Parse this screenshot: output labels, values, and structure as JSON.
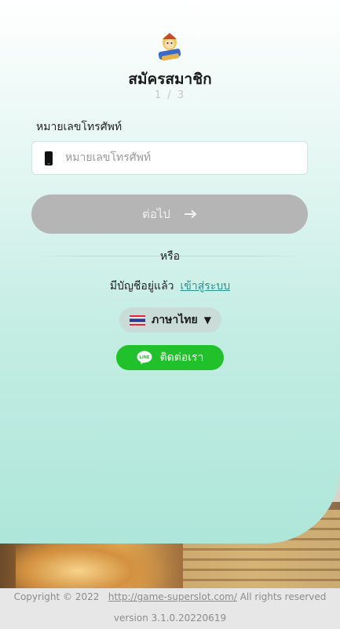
{
  "header": {
    "title": "สมัครสมาชิก",
    "step": "1 / 3"
  },
  "form": {
    "phone_label": "หมายเลขโทรศัพท์",
    "phone_value": "",
    "phone_placeholder": "หมายเลขโทรศัพท์",
    "next_label": "ต่อไป"
  },
  "divider": {
    "or_text": "หรือ"
  },
  "login": {
    "prompt": "มีบัญชีอยู่แล้ว",
    "link_label": "เข้าสู่ระบบ"
  },
  "language": {
    "selected": "ภาษาไทย",
    "icon": "thai-flag-icon"
  },
  "contact": {
    "label": "ติดต่อเรา",
    "icon": "line-icon",
    "icon_text": "LINE"
  },
  "footer": {
    "copyright_prefix": "Copyright © 2022",
    "site_link": "http://game-superslot.com/",
    "copyright_suffix": "All rights reserved",
    "version": "version 3.1.0.20220619"
  },
  "colors": {
    "primary_teal": "#2a8f8a",
    "button_disabled": "#b5b5b5",
    "line_green": "#20c12a",
    "background_mint": "#c4ede3"
  }
}
